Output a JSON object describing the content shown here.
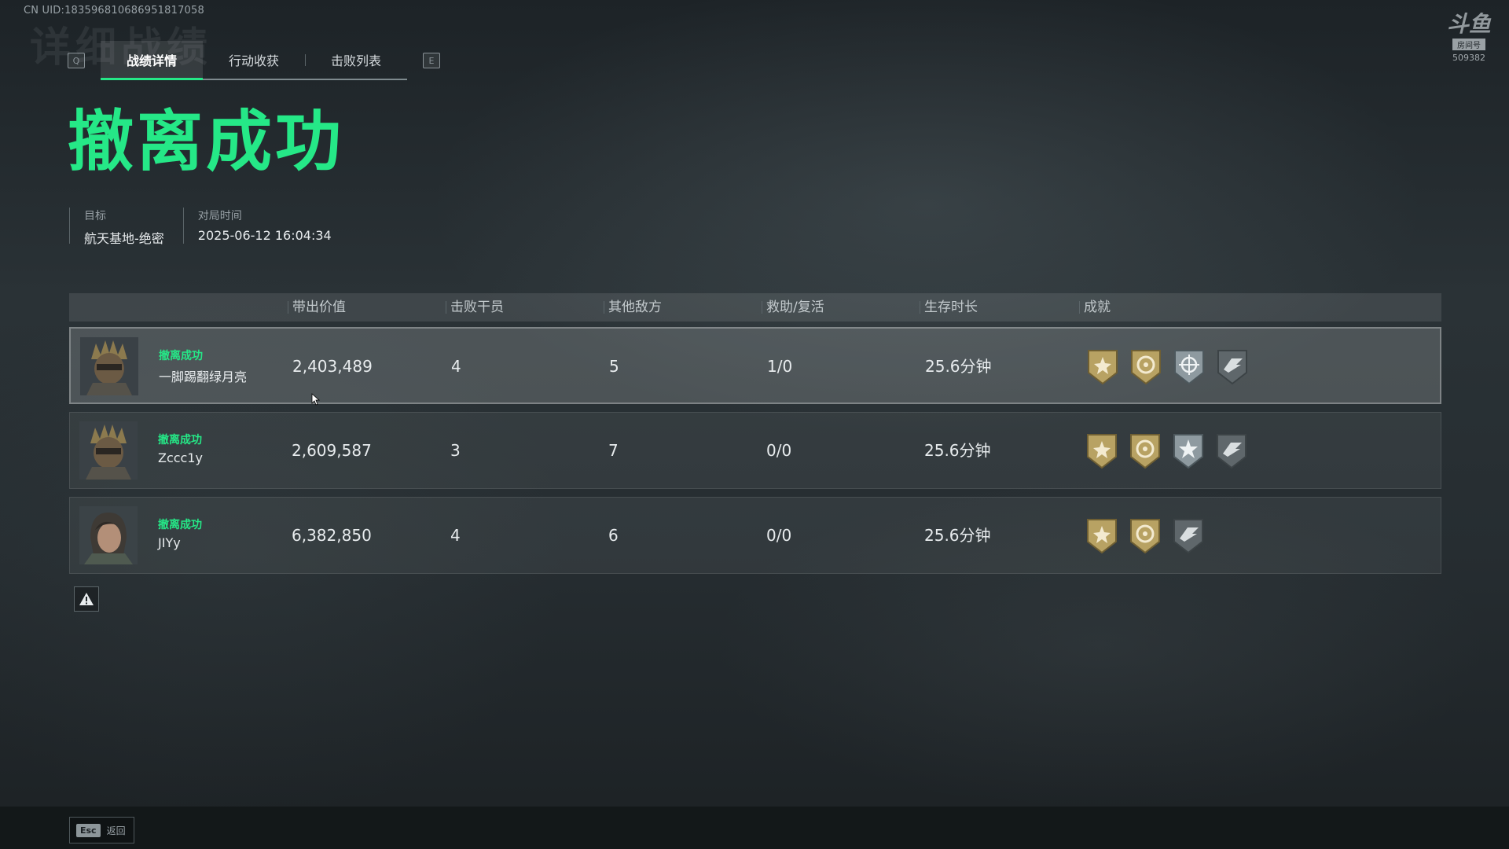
{
  "uid": "CN UID:1835968106869​51817058",
  "watermark": {
    "logo": "斗鱼",
    "sub": "房间号",
    "room": "509382"
  },
  "tabs": {
    "prev_key": "Q",
    "next_key": "E",
    "items": [
      {
        "label": "战绩详情",
        "active": true
      },
      {
        "label": "行动收获",
        "active": false
      },
      {
        "label": "击败列表",
        "active": false
      }
    ]
  },
  "result_title": "撤离成功",
  "meta": {
    "target_label": "目标",
    "target_value": "航天基地-绝密",
    "time_label": "对局时间",
    "time_value": "2025-06-12 16:04:34"
  },
  "table": {
    "headers": [
      "带出价值",
      "击败干员",
      "其他敌方",
      "救助/复活",
      "生存时长",
      "成就"
    ],
    "rows": [
      {
        "status": "撤离成功",
        "name": "一脚踢翻绿月亮",
        "value": "2,403,489",
        "kills": "4",
        "others": "5",
        "assist": "1/0",
        "survival": "25.6分钟",
        "selected": true,
        "badges": [
          "gold-sun-badge-icon",
          "gold-target-badge-icon",
          "silver-crosshair-badge-icon",
          "gray-wing-badge-icon"
        ]
      },
      {
        "status": "撤离成功",
        "name": "Zccc1y",
        "value": "2,609,587",
        "kills": "3",
        "others": "7",
        "assist": "0/0",
        "survival": "25.6分钟",
        "selected": false,
        "badges": [
          "gold-sun-badge-icon",
          "gold-target-badge-icon",
          "silver-star-badge-icon",
          "gray-wing-badge-icon"
        ]
      },
      {
        "status": "撤离成功",
        "name": "JIYy",
        "value": "6,382,850",
        "kills": "4",
        "others": "6",
        "assist": "0/0",
        "survival": "25.6分钟",
        "selected": false,
        "badges": [
          "gold-sun-badge-icon",
          "gold-target-badge-icon",
          "gray-wing-badge-icon"
        ]
      }
    ]
  },
  "footer": {
    "key": "Esc",
    "label": "返回"
  },
  "colors": {
    "accent": "#25e887",
    "badge_gold": "#b8a263",
    "badge_silver": "#8e9aa0"
  }
}
